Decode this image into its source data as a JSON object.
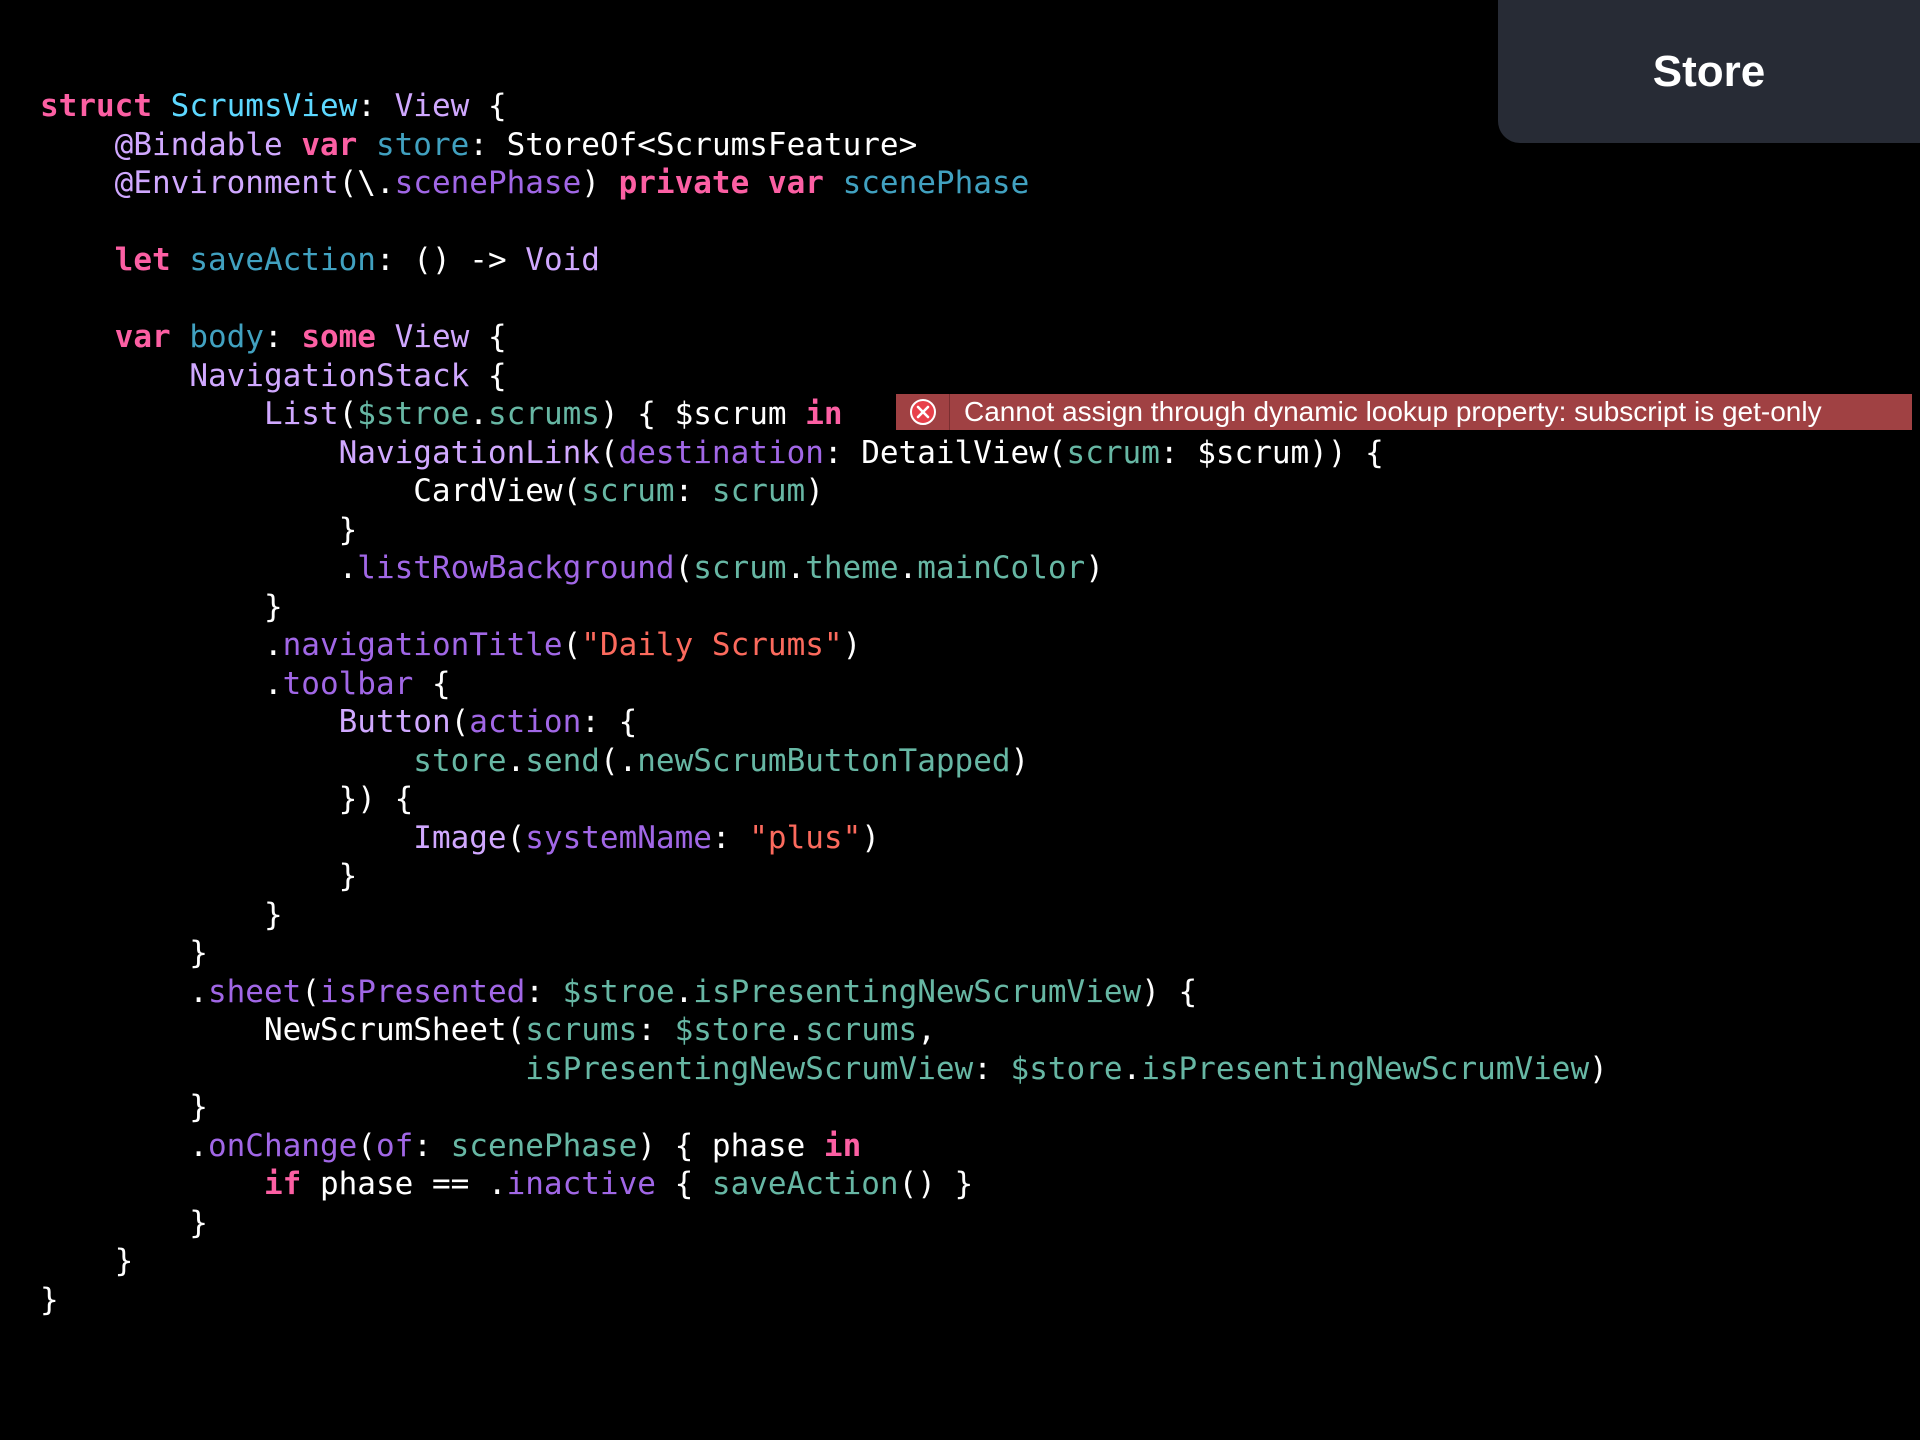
{
  "badge": {
    "label": "Store"
  },
  "error": {
    "icon": "error-circle-x-icon",
    "message": "Cannot assign through dynamic lookup property: subscript is get-only",
    "line_index": 8
  },
  "colors": {
    "background": "#000000",
    "keyword": "#fc5fa3",
    "type": "#d0a8ff",
    "declaration": "#5dd8ff",
    "variable": "#41a1c0",
    "function": "#a167e6",
    "project": "#67b7a4",
    "string": "#fc6a5d",
    "plain": "#ffffff",
    "error_banner": "#a04143",
    "badge_bg": "#272b35"
  },
  "code": {
    "language": "swift",
    "lines": [
      [
        [
          "kw",
          "struct"
        ],
        [
          "pln",
          " "
        ],
        [
          "dec",
          "ScrumsView"
        ],
        [
          "pln",
          ": "
        ],
        [
          "typ",
          "View"
        ],
        [
          "pln",
          " {"
        ]
      ],
      [
        [
          "pln",
          "    "
        ],
        [
          "typ",
          "@Bindable"
        ],
        [
          "pln",
          " "
        ],
        [
          "kw",
          "var"
        ],
        [
          "pln",
          " "
        ],
        [
          "var",
          "store"
        ],
        [
          "pln",
          ": StoreOf<ScrumsFeature>"
        ]
      ],
      [
        [
          "pln",
          "    "
        ],
        [
          "typ",
          "@Environment"
        ],
        [
          "pln",
          "(\\."
        ],
        [
          "fn",
          "scenePhase"
        ],
        [
          "pln",
          ") "
        ],
        [
          "kw",
          "private"
        ],
        [
          "pln",
          " "
        ],
        [
          "kw",
          "var"
        ],
        [
          "pln",
          " "
        ],
        [
          "var",
          "scenePhase"
        ]
      ],
      [],
      [
        [
          "pln",
          "    "
        ],
        [
          "kw",
          "let"
        ],
        [
          "pln",
          " "
        ],
        [
          "var",
          "saveAction"
        ],
        [
          "pln",
          ": () -> "
        ],
        [
          "typ",
          "Void"
        ]
      ],
      [],
      [
        [
          "pln",
          "    "
        ],
        [
          "kw",
          "var"
        ],
        [
          "pln",
          " "
        ],
        [
          "var",
          "body"
        ],
        [
          "pln",
          ": "
        ],
        [
          "kw",
          "some"
        ],
        [
          "pln",
          " "
        ],
        [
          "typ",
          "View"
        ],
        [
          "pln",
          " {"
        ]
      ],
      [
        [
          "pln",
          "        "
        ],
        [
          "typ",
          "NavigationStack"
        ],
        [
          "pln",
          " {"
        ]
      ],
      [
        [
          "pln",
          "            "
        ],
        [
          "typ",
          "List"
        ],
        [
          "pln",
          "("
        ],
        [
          "prj",
          "$stroe"
        ],
        [
          "pln",
          "."
        ],
        [
          "prj",
          "scrums"
        ],
        [
          "pln",
          ") { $scrum "
        ],
        [
          "kw",
          "in"
        ]
      ],
      [
        [
          "pln",
          "                "
        ],
        [
          "typ",
          "NavigationLink"
        ],
        [
          "pln",
          "("
        ],
        [
          "fn",
          "destination"
        ],
        [
          "pln",
          ": DetailView("
        ],
        [
          "prj",
          "scrum"
        ],
        [
          "pln",
          ": $scrum)) {"
        ]
      ],
      [
        [
          "pln",
          "                    CardView("
        ],
        [
          "prj",
          "scrum"
        ],
        [
          "pln",
          ": "
        ],
        [
          "prj",
          "scrum"
        ],
        [
          "pln",
          ")"
        ]
      ],
      [
        [
          "pln",
          "                }"
        ]
      ],
      [
        [
          "pln",
          "                ."
        ],
        [
          "fn",
          "listRowBackground"
        ],
        [
          "pln",
          "("
        ],
        [
          "prj",
          "scrum"
        ],
        [
          "pln",
          "."
        ],
        [
          "prj",
          "theme"
        ],
        [
          "pln",
          "."
        ],
        [
          "prj",
          "mainColor"
        ],
        [
          "pln",
          ")"
        ]
      ],
      [
        [
          "pln",
          "            }"
        ]
      ],
      [
        [
          "pln",
          "            ."
        ],
        [
          "fn",
          "navigationTitle"
        ],
        [
          "pln",
          "("
        ],
        [
          "str",
          "\"Daily Scrums\""
        ],
        [
          "pln",
          ")"
        ]
      ],
      [
        [
          "pln",
          "            ."
        ],
        [
          "fn",
          "toolbar"
        ],
        [
          "pln",
          " {"
        ]
      ],
      [
        [
          "pln",
          "                "
        ],
        [
          "typ",
          "Button"
        ],
        [
          "pln",
          "("
        ],
        [
          "fn",
          "action"
        ],
        [
          "pln",
          ": {"
        ]
      ],
      [
        [
          "pln",
          "                    "
        ],
        [
          "prj",
          "store"
        ],
        [
          "pln",
          "."
        ],
        [
          "prj",
          "send"
        ],
        [
          "pln",
          "(."
        ],
        [
          "prj",
          "newScrumButtonTapped"
        ],
        [
          "pln",
          ")"
        ]
      ],
      [
        [
          "pln",
          "                }) {"
        ]
      ],
      [
        [
          "pln",
          "                    "
        ],
        [
          "typ",
          "Image"
        ],
        [
          "pln",
          "("
        ],
        [
          "fn",
          "systemName"
        ],
        [
          "pln",
          ": "
        ],
        [
          "str",
          "\"plus\""
        ],
        [
          "pln",
          ")"
        ]
      ],
      [
        [
          "pln",
          "                }"
        ]
      ],
      [
        [
          "pln",
          "            }"
        ]
      ],
      [
        [
          "pln",
          "        }"
        ]
      ],
      [
        [
          "pln",
          "        ."
        ],
        [
          "fn",
          "sheet"
        ],
        [
          "pln",
          "("
        ],
        [
          "fn",
          "isPresented"
        ],
        [
          "pln",
          ": "
        ],
        [
          "prj",
          "$stroe"
        ],
        [
          "pln",
          "."
        ],
        [
          "prj",
          "isPresentingNewScrumView"
        ],
        [
          "pln",
          ") {"
        ]
      ],
      [
        [
          "pln",
          "            NewScrumSheet("
        ],
        [
          "prj",
          "scrums"
        ],
        [
          "pln",
          ": "
        ],
        [
          "prj",
          "$store"
        ],
        [
          "pln",
          "."
        ],
        [
          "prj",
          "scrums"
        ],
        [
          "pln",
          ","
        ]
      ],
      [
        [
          "pln",
          "                          "
        ],
        [
          "prj",
          "isPresentingNewScrumView"
        ],
        [
          "pln",
          ": "
        ],
        [
          "prj",
          "$store"
        ],
        [
          "pln",
          "."
        ],
        [
          "prj",
          "isPresentingNewScrumView"
        ],
        [
          "pln",
          ")"
        ]
      ],
      [
        [
          "pln",
          "        }"
        ]
      ],
      [
        [
          "pln",
          "        ."
        ],
        [
          "fn",
          "onChange"
        ],
        [
          "pln",
          "("
        ],
        [
          "fn",
          "of"
        ],
        [
          "pln",
          ": "
        ],
        [
          "prj",
          "scenePhase"
        ],
        [
          "pln",
          ") { phase "
        ],
        [
          "kw",
          "in"
        ]
      ],
      [
        [
          "pln",
          "            "
        ],
        [
          "kw",
          "if"
        ],
        [
          "pln",
          " phase == ."
        ],
        [
          "fn",
          "inactive"
        ],
        [
          "pln",
          " { "
        ],
        [
          "prj",
          "saveAction"
        ],
        [
          "pln",
          "() }"
        ]
      ],
      [
        [
          "pln",
          "        }"
        ]
      ],
      [
        [
          "pln",
          "    }"
        ]
      ],
      [
        [
          "pln",
          "}"
        ]
      ]
    ]
  }
}
